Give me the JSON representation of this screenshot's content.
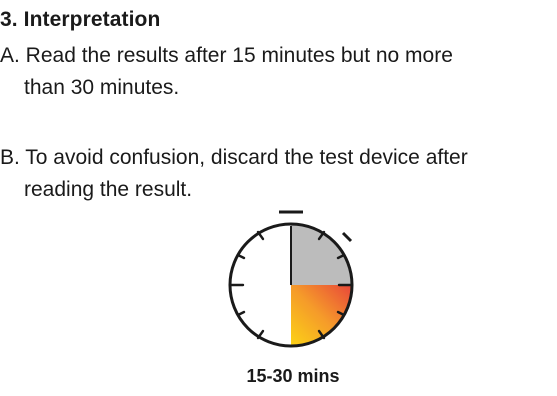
{
  "section": {
    "heading": "3. Interpretation"
  },
  "instructions": [
    {
      "line1": "A. Read the results after 15 minutes but no more",
      "line2": "than 30 minutes."
    },
    {
      "line1": "B. To avoid confusion, discard the test device after",
      "line2": "reading the result."
    }
  ],
  "timer": {
    "icon": "stopwatch-icon",
    "elapsed_segment": {
      "from_minute": 0,
      "to_minute": 15,
      "color": "#bcbcbc"
    },
    "window_segment": {
      "from_minute": 15,
      "to_minute": 30,
      "gradient_colors": [
        "#e8463a",
        "#f59a2a",
        "#fcd316"
      ]
    },
    "caption": "15-30 mins"
  }
}
